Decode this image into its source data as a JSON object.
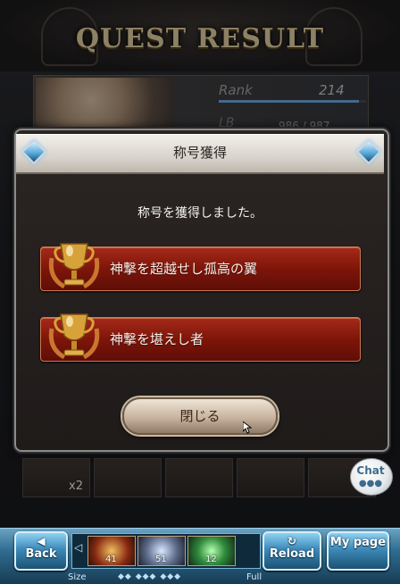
{
  "header": {
    "title": "QUEST RESULT"
  },
  "rank_panel": {
    "rank_label": "Rank",
    "rank_value": "214",
    "lb_label": "LB",
    "lb_value": "986 / 987",
    "rank_progress": 0.95
  },
  "modal": {
    "title": "称号獲得",
    "message": "称号を獲得しました。",
    "titles": [
      {
        "name": "神撃を超越せし孤高の翼",
        "icon": "trophy-icon"
      },
      {
        "name": "神撃を堪えし者",
        "icon": "trophy-icon"
      }
    ],
    "close_label": "閉じる"
  },
  "items": {
    "quantity": "x2"
  },
  "chat": {
    "label": "Chat",
    "dots": "●●●"
  },
  "bottom_bar": {
    "back_label": "Back",
    "reload_label": "Reload",
    "mypage_label": "My page",
    "quick_items": [
      {
        "count": "41",
        "icon": "sword-item-icon"
      },
      {
        "count": "51",
        "icon": "orb-item-icon"
      },
      {
        "count": "12",
        "icon": "green-gem-icon"
      }
    ],
    "size_label": "Size",
    "full_label": "Full",
    "size_dots": "◆◆ ◆◆◆ ◆◆◆"
  },
  "colors": {
    "accent_red": "#7e1509",
    "nav_blue": "#3d8ab9",
    "title_bar": "#e6e1da"
  }
}
